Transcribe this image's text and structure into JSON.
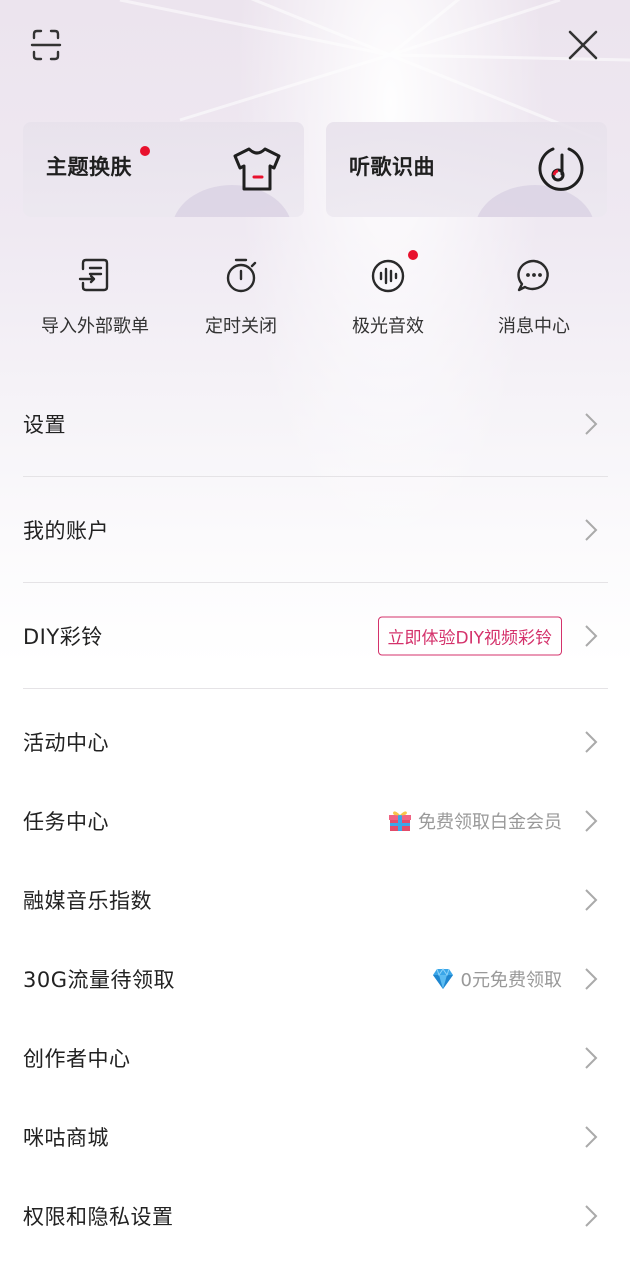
{
  "header": {
    "scan_icon": "scan-icon",
    "close_icon": "close-icon"
  },
  "cards": [
    {
      "label": "主题换肤",
      "icon": "tshirt-icon",
      "has_dot": true
    },
    {
      "label": "听歌识曲",
      "icon": "music-recognize-icon",
      "has_dot": false
    }
  ],
  "tools": [
    {
      "label": "导入外部歌单",
      "icon": "import-playlist-icon",
      "has_dot": false
    },
    {
      "label": "定时关闭",
      "icon": "timer-icon",
      "has_dot": false
    },
    {
      "label": "极光音效",
      "icon": "sound-effect-icon",
      "has_dot": true
    },
    {
      "label": "消息中心",
      "icon": "message-icon",
      "has_dot": false
    }
  ],
  "menu": {
    "settings": "设置",
    "account": "我的账户",
    "diy": "DIY彩铃",
    "diy_tag": "立即体验DIY视频彩铃",
    "activity": "活动中心",
    "task": "任务中心",
    "task_hint": "免费领取白金会员",
    "index": "融媒音乐指数",
    "traffic": "30G流量待领取",
    "traffic_hint": "0元免费领取",
    "creator": "创作者中心",
    "mall": "咪咕商城",
    "privacy": "权限和隐私设置"
  },
  "colors": {
    "accent": "#d4326b",
    "dot": "#e8112d",
    "hint_text": "#999999"
  }
}
